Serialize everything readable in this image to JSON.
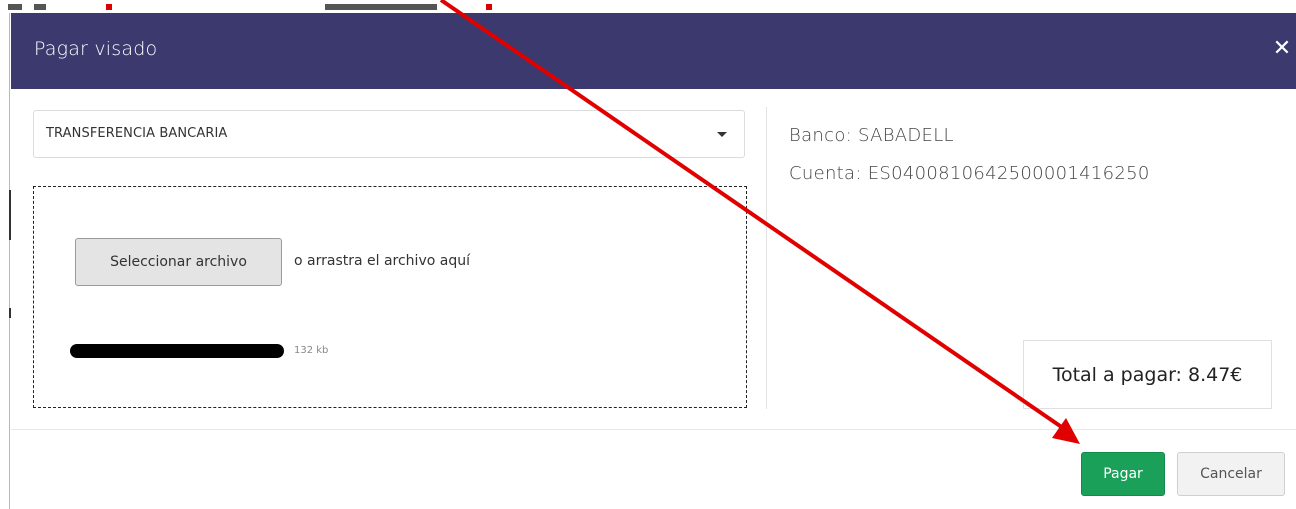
{
  "modal": {
    "title": "Pagar visado",
    "close_glyph": "✕"
  },
  "payment_method": {
    "selected": "TRANSFERENCIA BANCARIA"
  },
  "upload": {
    "select_button_label": "Seleccionar archivo",
    "drop_hint": "o arrastra el archivo aquí",
    "file": {
      "name": "",
      "size": "132 kb",
      "name_redacted": true
    }
  },
  "bank": {
    "bank_line": "Banco: SABADELL",
    "account_line": "Cuenta: ES0400810642500001416250"
  },
  "total": {
    "text": "Total a pagar: 8.47€"
  },
  "footer": {
    "pay_label": "Pagar",
    "cancel_label": "Cancelar"
  },
  "colors": {
    "header_bg": "#3b396e",
    "pay_button": "#1ba05a",
    "annotation_arrow": "#e00000"
  },
  "icons": {
    "close": "close-icon",
    "caret": "chevron-down-icon"
  }
}
